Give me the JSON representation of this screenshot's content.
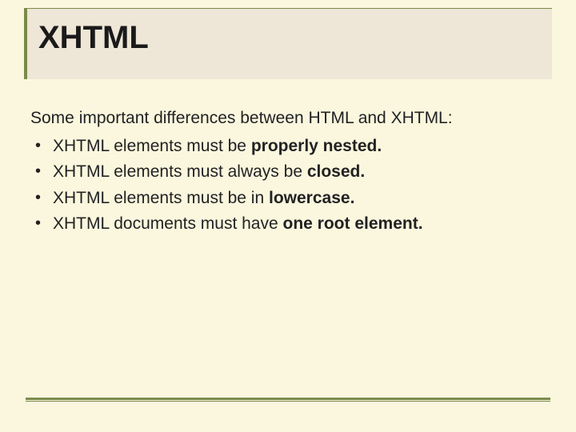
{
  "title": "XHTML",
  "intro": "Some important differences between HTML and XHTML:",
  "bullets": [
    {
      "prefix": "XHTML elements must be ",
      "bold": "properly nested."
    },
    {
      "prefix": "XHTML elements must always be ",
      "bold": "closed."
    },
    {
      "prefix": "XHTML elements must be in ",
      "bold": "lowercase."
    },
    {
      "prefix": "XHTML documents must have ",
      "bold": "one root element."
    }
  ]
}
